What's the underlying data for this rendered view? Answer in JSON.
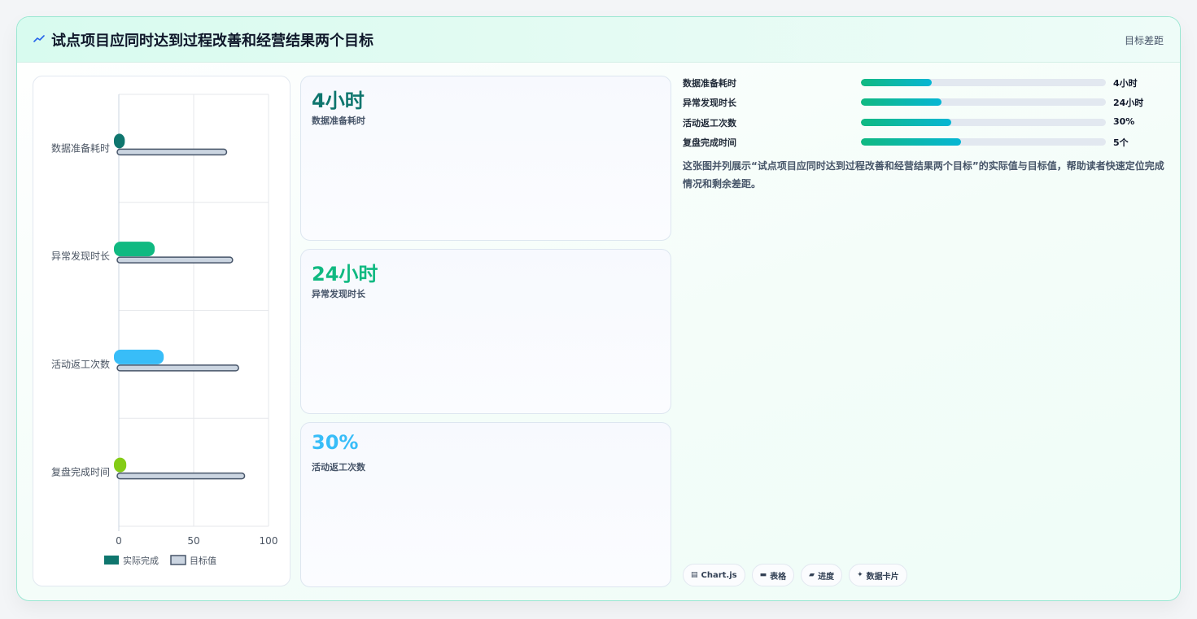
{
  "header": {
    "title": "试点项目应同时达到过程改善和经营结果两个目标",
    "link": "目标差距",
    "icon": "trend-icon"
  },
  "metrics": [
    {
      "value": "4小时",
      "label": "数据准备耗时",
      "color": "#0f766e"
    },
    {
      "value": "24小时",
      "label": "异常发现时长",
      "color": "#10b981"
    },
    {
      "value": "30%",
      "label": "活动返工次数",
      "color": "#38bdf8"
    }
  ],
  "progress": [
    {
      "label": "数据准备耗时",
      "value": "4小时",
      "fraction": 0.29
    },
    {
      "label": "异常发现时长",
      "value": "24小时",
      "fraction": 0.33
    },
    {
      "label": "活动返工次数",
      "value": "30%",
      "fraction": 0.37
    },
    {
      "label": "复盘完成时间",
      "value": "5个",
      "fraction": 0.41
    }
  ],
  "description": "这张图并列展示“试点项目应同时达到过程改善和经营结果两个目标”的实际值与目标值，帮助读者快速定位完成情况和剩余差距。",
  "tags": [
    {
      "icon": "chart-icon",
      "glyph": "▤",
      "label": "Chart.js"
    },
    {
      "icon": "table-icon",
      "glyph": "▬",
      "label": "表格"
    },
    {
      "icon": "progress-icon",
      "glyph": "▰",
      "label": "进度"
    },
    {
      "icon": "sparkle-icon",
      "glyph": "✦",
      "label": "数据卡片"
    }
  ],
  "chart_data": {
    "type": "bar",
    "orientation": "horizontal",
    "categories": [
      "数据准备耗时",
      "异常发现时长",
      "活动返工次数",
      "复盘完成时间"
    ],
    "series": [
      {
        "name": "实际完成",
        "values": [
          4,
          24,
          30,
          5
        ],
        "colors": [
          "#0f766e",
          "#10b981",
          "#38bdf8",
          "#84cc16"
        ]
      },
      {
        "name": "目标值",
        "values": [
          72,
          76,
          80,
          84
        ],
        "color": "#cbd5e1"
      }
    ],
    "xlim": [
      0,
      100
    ],
    "xticks": [
      "0",
      "50",
      "100"
    ],
    "grid": true,
    "legend": "bottom"
  }
}
